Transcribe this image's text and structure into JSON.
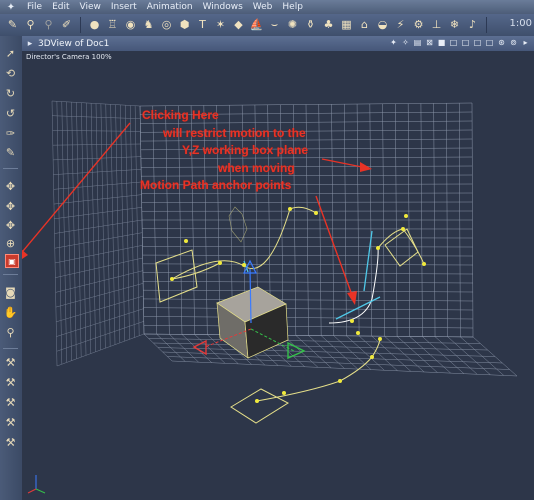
{
  "menubar": {
    "items": [
      "File",
      "Edit",
      "View",
      "Insert",
      "Animation",
      "Windows",
      "Web",
      "Help"
    ]
  },
  "toolbar": {
    "frame_readout": "1:00"
  },
  "view": {
    "title": "3DView of Doc1",
    "camera_label": "Director's Camera 100%"
  },
  "annotation": {
    "lines": [
      "Clicking Here",
      "will restrict motion to the",
      "Y,Z working box plane",
      "when moving",
      "Motion Path anchor points"
    ],
    "color": "#e83326"
  },
  "colors": {
    "background": "#2d3649",
    "grid": "#a9b4c8",
    "motion_path": "#e6e08a",
    "anchor_point": "#f0ea3c",
    "tangent": "#4fc8e8",
    "annotation": "#e83326"
  },
  "icons": {
    "left_toolbox": [
      "arrow-select",
      "rotate",
      "twist",
      "spin",
      "brush",
      "warp",
      "move-xy",
      "move-xz",
      "move-yz",
      "trackball",
      "restrict-yz",
      "camera",
      "hand",
      "zoom",
      "bone",
      "bend",
      "taper",
      "scale"
    ]
  }
}
